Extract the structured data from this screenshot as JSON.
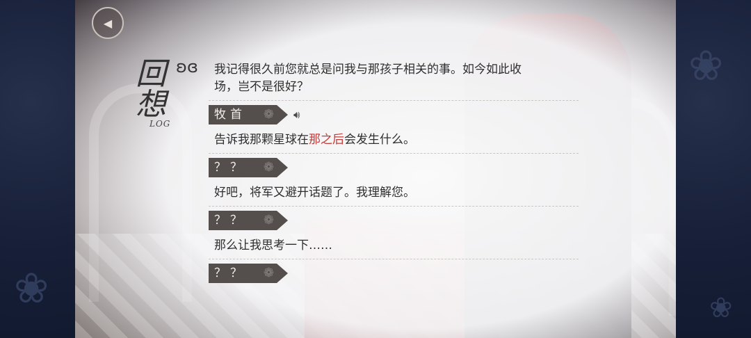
{
  "title": {
    "char1": "回",
    "char2": "想",
    "sub": "LOG"
  },
  "entries": [
    {
      "speaker": null,
      "text_plain": "我记得很久前您就总是问我与那孩子相关的事。如今如此收场，岂不是很好？"
    },
    {
      "speaker": "牧首",
      "voice": true,
      "text_before": "告诉我那颗星球在",
      "text_highlight": "那之后",
      "text_after": "会发生什么。"
    },
    {
      "speaker": "？？",
      "voice": false,
      "text": "好吧，将军又避开话题了。我理解您。"
    },
    {
      "speaker": "？？",
      "voice": false,
      "text": "那么让我思考一下……"
    },
    {
      "speaker": "？？",
      "voice": false,
      "text": ""
    }
  ],
  "first_line_1": "我记得很久前您就总是问我与那孩子相关的事。如今如此收",
  "first_line_2": "场，岂不是很好？",
  "colors": {
    "tag_bg": "#544e4d",
    "highlight": "#c33a3a"
  },
  "icons": {
    "back": "back-arrow-icon",
    "voice": "speaker-icon",
    "rose": "rose-icon",
    "butterfly": "butterfly-icon"
  }
}
